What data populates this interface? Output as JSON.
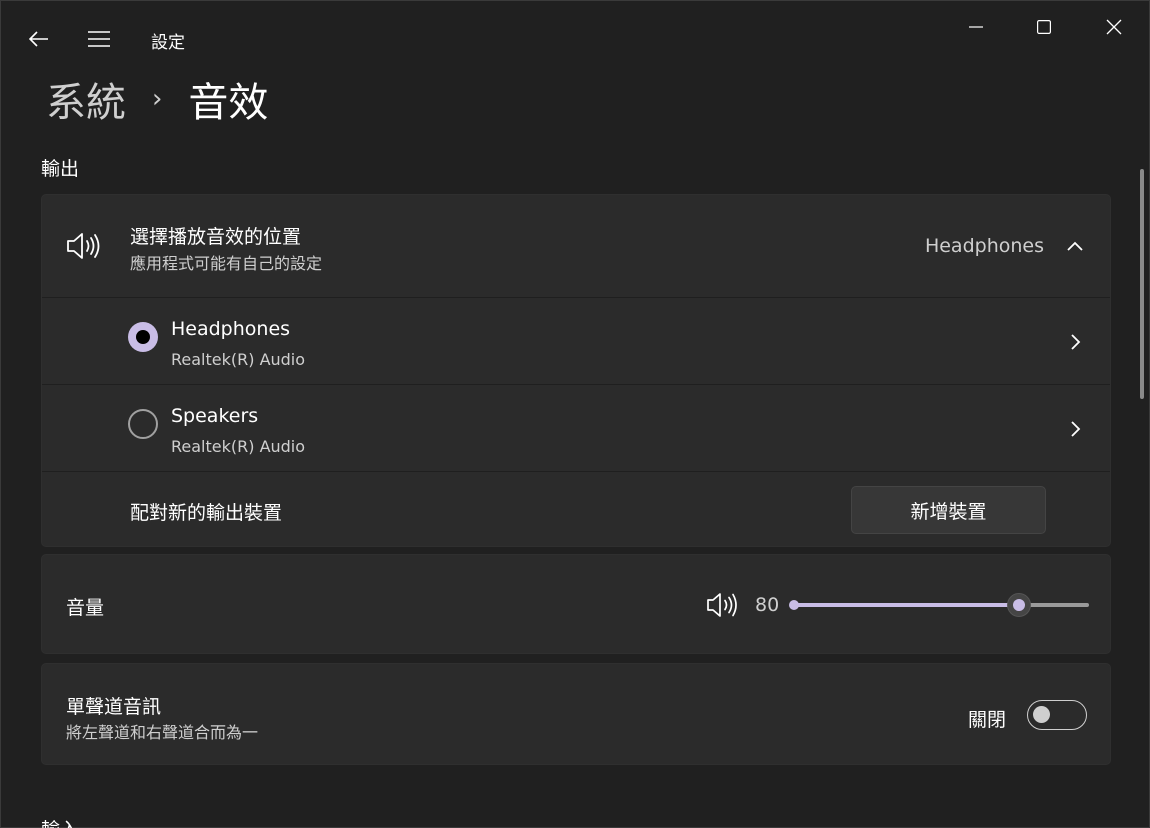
{
  "window": {
    "title": "設定"
  },
  "breadcrumb": {
    "parent": "系統",
    "separator": "›",
    "current": "音效"
  },
  "output": {
    "section_label": "輸出",
    "header": {
      "title": "選擇播放音效的位置",
      "subtitle": "應用程式可能有自己的設定",
      "selected_value": "Headphones"
    },
    "devices": [
      {
        "name": "Headphones",
        "subtitle": "Realtek(R) Audio",
        "selected": true
      },
      {
        "name": "Speakers",
        "subtitle": "Realtek(R) Audio",
        "selected": false
      }
    ],
    "pair": {
      "label": "配對新的輸出裝置",
      "button_label": "新增裝置"
    }
  },
  "volume": {
    "label": "音量",
    "value": "80",
    "level_fraction": 0.8
  },
  "mono": {
    "title": "單聲道音訊",
    "subtitle": "將左聲道和右聲道合而為一",
    "state_label": "關閉",
    "on": false
  },
  "next_section_label": "輸入",
  "colors": {
    "accent": "#c9bde6",
    "card": "#2b2b2b",
    "window": "#202020"
  }
}
